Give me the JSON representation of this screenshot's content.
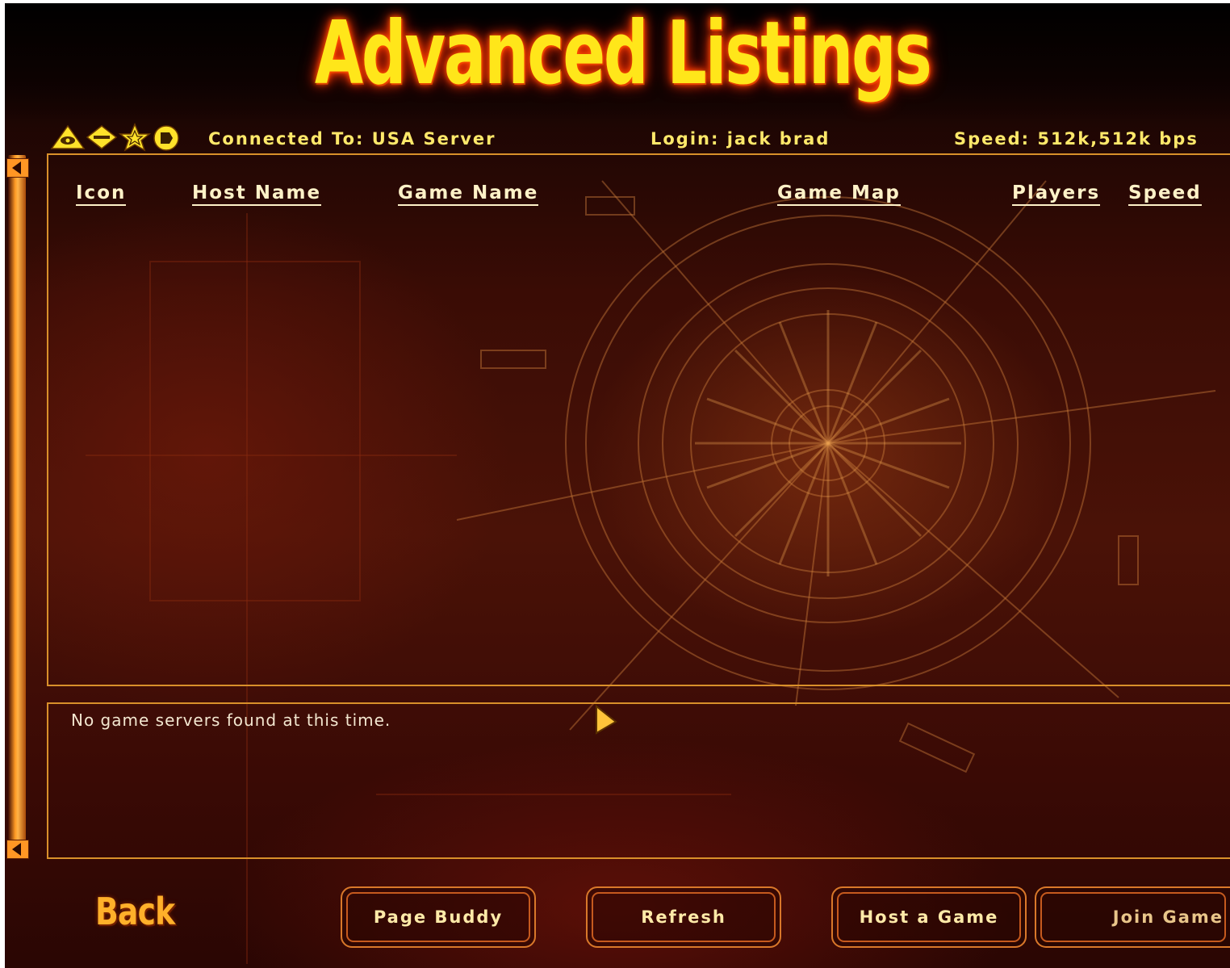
{
  "window": {
    "title": "Advanced Listings"
  },
  "status": {
    "connected": "Connected To: USA Server",
    "login": "Login: jack brad",
    "speed": "Speed: 512k,512k bps",
    "icons": [
      "eye-triangle-icon",
      "key-diamond-icon",
      "star-icon",
      "buddy-disc-icon"
    ]
  },
  "columns": [
    "Icon",
    "Host Name",
    "Game Name",
    "Game Map",
    "Players",
    "Speed"
  ],
  "messages": {
    "text": "No game servers found at this time."
  },
  "buttons": {
    "back": "Back",
    "page_buddy": "Page Buddy",
    "refresh": "Refresh",
    "host": "Host a Game",
    "join": "Join Game"
  },
  "colors": {
    "title": "#ffe61a",
    "frame": "#d9902a",
    "text": "#ffe86a",
    "background": "#3a0c05"
  }
}
